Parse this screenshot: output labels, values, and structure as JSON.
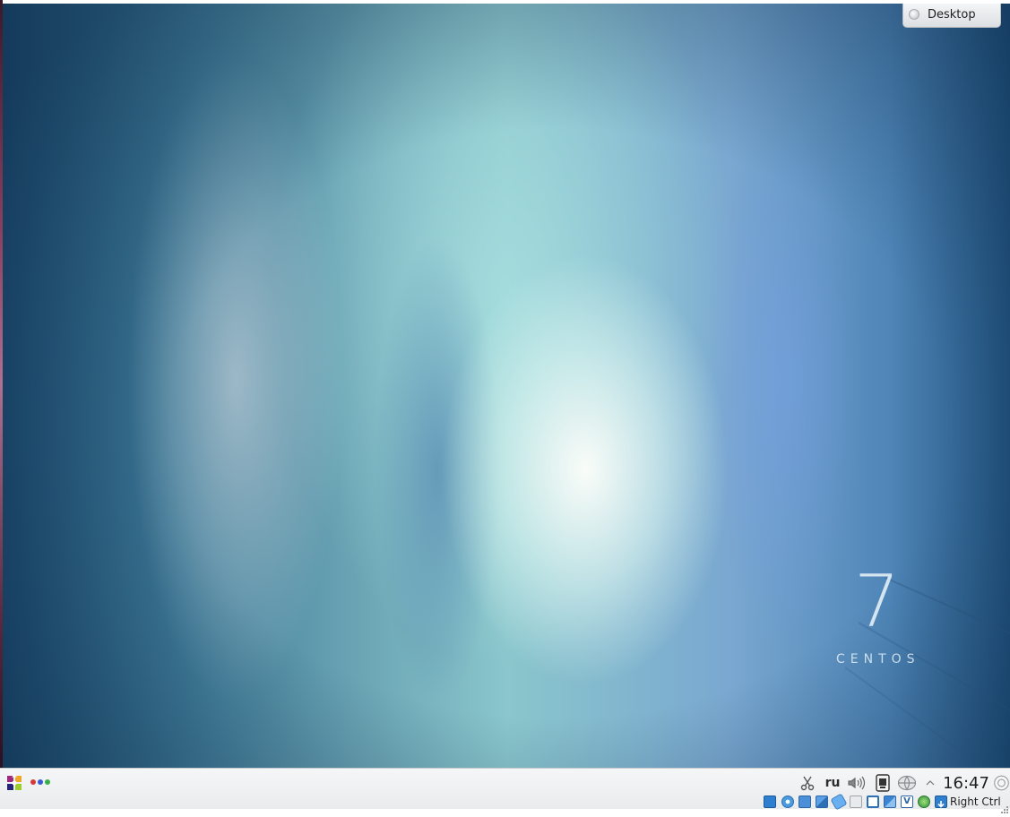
{
  "desktop": {
    "branding": {
      "number": "7",
      "word": "CENTOS"
    },
    "activity_tab": {
      "label": "Desktop",
      "icon": "activity-icon"
    },
    "colors": {
      "sky_dark": "#1d4a6e",
      "sky_mid": "#6aa4b4",
      "glow": "#f5fbf6"
    }
  },
  "panel": {
    "launcher_icon": "application-launcher-icon",
    "pager_icon": "virtual-desktop-pager-icon",
    "tray": {
      "clipboard_icon": "scissors-icon",
      "keyboard_layout": "ru",
      "volume_icon": "speaker-icon",
      "notifier_icon": "device-notifier-icon",
      "network_icon": "network-icon",
      "expand_icon": "chevron-up-icon",
      "clock": "16:47",
      "cashew_icon": "panel-toolbox-icon"
    }
  },
  "vbox_status": {
    "icons": [
      "hard-disk-icon",
      "optical-drive-icon",
      "audio-icon",
      "network-adapter-icon",
      "usb-icon",
      "shared-folders-icon",
      "display-icon",
      "video-capture-icon",
      "virtualization-icon",
      "mouse-integration-icon",
      "download-icon"
    ],
    "host_key": "Right Ctrl"
  }
}
